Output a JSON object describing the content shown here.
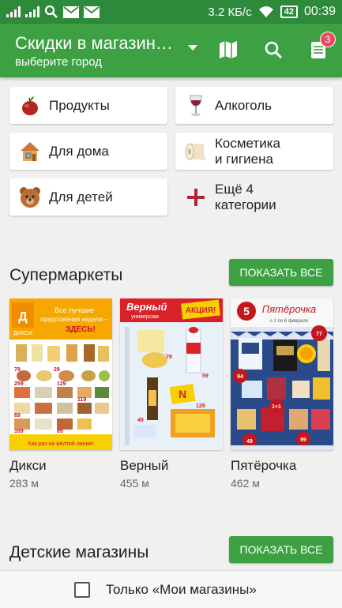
{
  "status_bar": {
    "speed": "3.2 КБ/с",
    "battery": "42",
    "time": "00:39"
  },
  "app_bar": {
    "title": "Скидки в магазин…",
    "subtitle": "выберите город",
    "cart_badge": "3"
  },
  "categories": [
    {
      "label": "Продукты",
      "icon": "apple-icon"
    },
    {
      "label": "Алкоголь",
      "icon": "wine-glass-icon"
    },
    {
      "label": "Для дома",
      "icon": "house-icon"
    },
    {
      "label": "Косметика\nи гигиена",
      "icon": "toilet-paper-icon"
    },
    {
      "label": "Для детей",
      "icon": "teddy-bear-icon"
    },
    {
      "label": "Ещё 4\nкатегории",
      "icon": "plus-icon"
    }
  ],
  "sections": [
    {
      "title": "Супермаркеты",
      "button": "ПОКАЗАТЬ ВСЕ"
    },
    {
      "title": "Детские магазины",
      "button": "ПОКАЗАТЬ ВСЕ"
    }
  ],
  "stores": [
    {
      "name": "Дикси",
      "distance": "283 м",
      "brand_color": "#f6a800",
      "poster_text": "Все лучшие предложения недели – ЗДЕСЬ!"
    },
    {
      "name": "Верный",
      "distance": "455 м",
      "brand_color": "#d92128",
      "poster_text": "Верный универсам АКЦИЯ!"
    },
    {
      "name": "Пятёрочка",
      "distance": "462 м",
      "brand_color": "#c5161d",
      "poster_text": "Пятёрочка"
    }
  ],
  "bottom_bar": {
    "label": "Только «Мои магазины»",
    "checked": false
  },
  "colors": {
    "primary": "#3da143",
    "status": "#2c8a3a",
    "badge": "#e84a5f"
  }
}
